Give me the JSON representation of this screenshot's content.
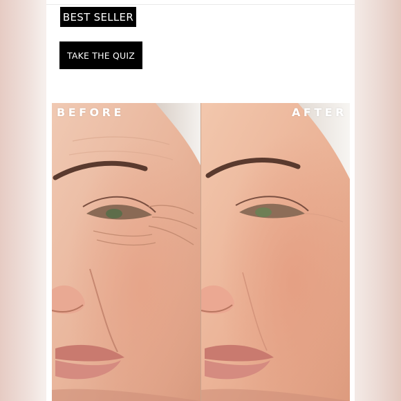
{
  "badge": {
    "label": "BEST SELLER"
  },
  "quiz": {
    "label": "TAKE THE QUIZ"
  },
  "comparison": {
    "before_label": "BEFORE",
    "after_label": "AFTER"
  },
  "colors": {
    "button_bg": "#000000",
    "button_text": "#ffffff",
    "card_bg": "#ffffff",
    "skin_tone": "#e8b79e"
  }
}
